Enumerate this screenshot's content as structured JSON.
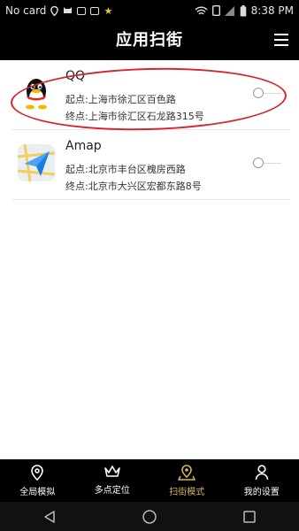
{
  "status_bar": {
    "carrier": "No card",
    "time": "8:38 PM"
  },
  "app_bar": {
    "title": "应用扫街",
    "menu_icon": "menu-icon"
  },
  "list": {
    "items": [
      {
        "name": "QQ",
        "start": "起点:上海市徐汇区百色路",
        "end": "终点:上海市徐汇区石龙路315号",
        "icon": "qq-penguin-icon",
        "selected": false
      },
      {
        "name": "Amap",
        "start": "起点:北京市丰台区槐房西路",
        "end": "终点:北京市大兴区宏都东路8号",
        "icon": "amap-arrow-icon",
        "selected": false
      }
    ]
  },
  "tab_bar": {
    "tabs": [
      {
        "label": "全局模拟",
        "icon": "location-pin-icon"
      },
      {
        "label": "多点定位",
        "icon": "crown-icon"
      },
      {
        "label": "扫街模式",
        "icon": "map-marker-icon",
        "active": true
      },
      {
        "label": "我的设置",
        "icon": "person-icon"
      }
    ],
    "active_color": "#d8b35a"
  },
  "colors": {
    "bar_background": "#000000",
    "highlight": "#d4262c"
  }
}
